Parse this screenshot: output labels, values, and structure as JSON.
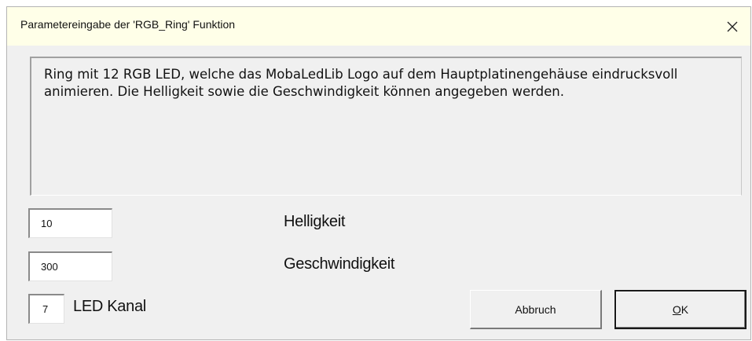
{
  "window": {
    "title": "Parametereingabe der 'RGB_Ring' Funktion",
    "close_glyph": "✕"
  },
  "description": "Ring mit 12 RGB LED, welche das MobaLedLib Logo auf dem Hauptplatinengehäuse eindrucksvoll animieren. Die Helligkeit sowie die Geschwindigkeit können angegeben werden.",
  "fields": {
    "helligkeit": {
      "value": "10",
      "label": "Helligkeit"
    },
    "geschwindigkeit": {
      "value": "300",
      "label": "Geschwindigkeit"
    },
    "led_kanal": {
      "value": "7",
      "label": "LED Kanal"
    }
  },
  "buttons": {
    "cancel_label": "Abbruch",
    "ok_mnemonic": "O",
    "ok_rest": "K"
  },
  "icons": {
    "close": "close-icon"
  },
  "colors": {
    "titlebar_bg": "#ffffe8",
    "dialog_bg": "#f0f0f0"
  }
}
